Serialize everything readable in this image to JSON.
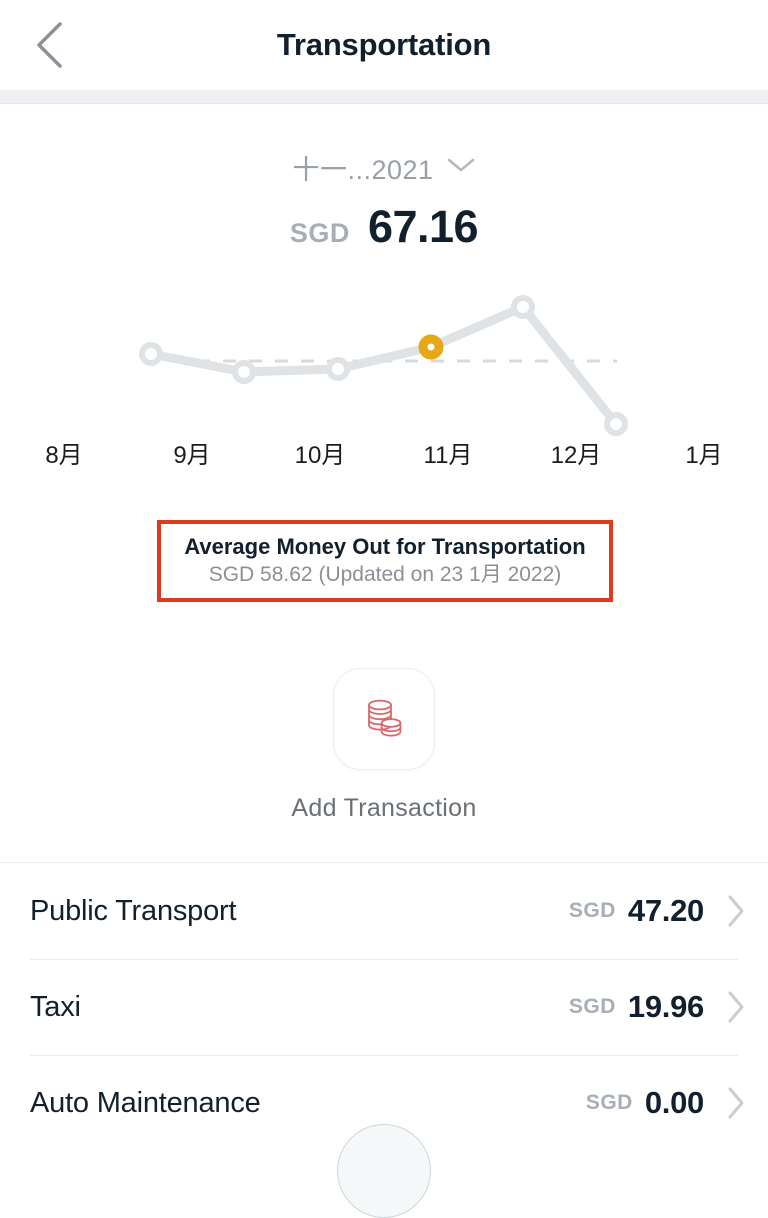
{
  "header": {
    "back_icon": "chevron-left-icon",
    "title": "Transportation"
  },
  "summary": {
    "month_label": "十一...2021",
    "chevron_icon": "chevron-down-icon",
    "currency": "SGD",
    "amount": "67.16"
  },
  "chart_data": {
    "type": "line",
    "title": "",
    "xlabel": "",
    "ylabel": "",
    "categories": [
      "8月",
      "9月",
      "10月",
      "11月",
      "12月",
      "1月"
    ],
    "values": [
      62.5,
      54.0,
      55.5,
      67.16,
      85.0,
      23.0
    ],
    "ylim": [
      0,
      100
    ],
    "grid": false,
    "legend": "none",
    "highlight_index": 3,
    "highlight_color": "#e6a817",
    "line_color": "#dfe3e6",
    "average_line": {
      "value": 58.62,
      "style": "dashed",
      "color": "#d6dadd"
    }
  },
  "average_note": {
    "title": "Average Money Out for Transportation",
    "subtitle": "SGD 58.62 (Updated on 23 1月 2022)",
    "highlight_color": "#e03a1e"
  },
  "add_transaction": {
    "icon": "coins-stack-icon",
    "icon_color": "#d9686e",
    "label": "Add Transaction"
  },
  "categories": [
    {
      "name": "Public Transport",
      "currency": "SGD",
      "amount": "47.20",
      "chevron": "chevron-right-icon"
    },
    {
      "name": "Taxi",
      "currency": "SGD",
      "amount": "19.96",
      "chevron": "chevron-right-icon"
    },
    {
      "name": "Auto Maintenance",
      "currency": "SGD",
      "amount": "0.00",
      "chevron": "chevron-right-icon"
    }
  ],
  "fab": {
    "icon": "circle-button"
  }
}
